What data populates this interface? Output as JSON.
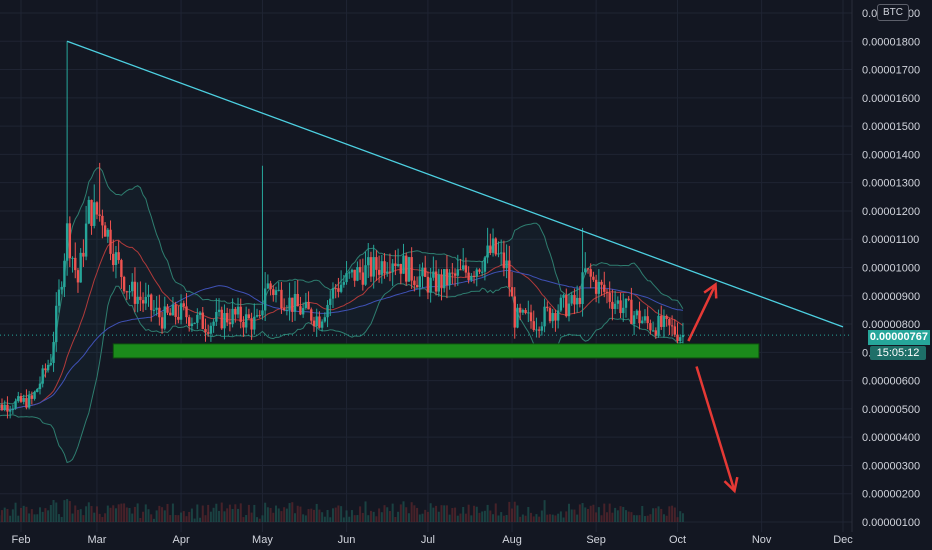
{
  "currency_label": "BTC",
  "last_price_label": "0.00000767",
  "countdown": "15:05:12",
  "colors": {
    "background": "#131722",
    "up_candle": "#26a69a",
    "down_candle": "#ef5350",
    "trendline": "#4dd0e1",
    "support_zone": "#1b8a1b",
    "arrow": "#e53935"
  },
  "chart_data": {
    "type": "candlestick",
    "y_ticks": [
      "0.00001900",
      "0.00001800",
      "0.00001700",
      "0.00001600",
      "0.00001500",
      "0.00001400",
      "0.00001300",
      "0.00001200",
      "0.00001100",
      "0.00001000",
      "0.00000900",
      "0.00000800",
      "0.00000700",
      "0.00000600",
      "0.00000500",
      "0.00000400",
      "0.00000300",
      "0.00000200",
      "0.00000100"
    ],
    "ylim": [
      7.6e-07,
      1.92e-05
    ],
    "x_ticks": [
      "Feb",
      "Mar",
      "Apr",
      "May",
      "Jun",
      "Jul",
      "Aug",
      "Sep",
      "Oct",
      "Nov",
      "Dec"
    ],
    "x_tick_dates": [
      "2021-02-01",
      "2021-03-01",
      "2021-04-01",
      "2021-05-01",
      "2021-06-01",
      "2021-07-01",
      "2021-08-01",
      "2021-09-01",
      "2021-10-01",
      "2021-11-01",
      "2021-12-01"
    ],
    "approx_series": {
      "name": "",
      "points": [
        [
          "2021-01-20",
          5e-06
        ],
        [
          "2021-02-05",
          5.3e-06
        ],
        [
          "2021-02-12",
          6.8e-06
        ],
        [
          "2021-02-15",
          9e-06
        ],
        [
          "2021-02-18",
          1.13e-05
        ],
        [
          "2021-02-22",
          9.5e-06
        ],
        [
          "2021-02-26",
          1.2e-05
        ],
        [
          "2021-03-03",
          1.18e-05
        ],
        [
          "2021-03-08",
          1.03e-05
        ],
        [
          "2021-03-12",
          9.3e-06
        ],
        [
          "2021-03-18",
          8.8e-06
        ],
        [
          "2021-03-25",
          8.2e-06
        ],
        [
          "2021-04-01",
          8.4e-06
        ],
        [
          "2021-04-10",
          8e-06
        ],
        [
          "2021-04-20",
          8.3e-06
        ],
        [
          "2021-04-30",
          8e-06
        ],
        [
          "2021-05-02",
          9.4e-06
        ],
        [
          "2021-05-08",
          9e-06
        ],
        [
          "2021-05-15",
          8.5e-06
        ],
        [
          "2021-05-22",
          8.2e-06
        ],
        [
          "2021-05-28",
          9.3e-06
        ],
        [
          "2021-06-05",
          9.8e-06
        ],
        [
          "2021-06-12",
          1e-05
        ],
        [
          "2021-06-18",
          1.04e-05
        ],
        [
          "2021-06-25",
          9.8e-06
        ],
        [
          "2021-07-02",
          9.4e-06
        ],
        [
          "2021-07-10",
          9.6e-06
        ],
        [
          "2021-07-18",
          1e-05
        ],
        [
          "2021-07-25",
          1.06e-05
        ],
        [
          "2021-07-30",
          1e-05
        ],
        [
          "2021-08-02",
          8.2e-06
        ],
        [
          "2021-08-10",
          8.1e-06
        ],
        [
          "2021-08-18",
          8.6e-06
        ],
        [
          "2021-08-25",
          8.7e-06
        ],
        [
          "2021-08-28",
          9.8e-06
        ],
        [
          "2021-09-02",
          9.3e-06
        ],
        [
          "2021-09-08",
          8.8e-06
        ],
        [
          "2021-09-14",
          8.4e-06
        ],
        [
          "2021-09-20",
          8e-06
        ],
        [
          "2021-09-26",
          7.9e-06
        ],
        [
          "2021-10-01",
          7.7e-06
        ],
        [
          "2021-10-03",
          7.6e-06
        ]
      ]
    },
    "highs": [
      [
        "2021-02-18",
        1.8e-05
      ],
      [
        "2021-03-02",
        1.37e-05
      ],
      [
        "2021-05-01",
        1.36e-05
      ],
      [
        "2021-08-27",
        1.14e-05
      ]
    ],
    "annotations": {
      "descending_trendline": [
        [
          "2021-02-18",
          1.8e-05
        ],
        [
          "2021-12-01",
          7.9e-06
        ]
      ],
      "support_zone": [
        [
          "2021-03-07",
          7.3e-06
        ],
        [
          "2021-10-31",
          6.8e-06
        ]
      ],
      "arrow_up": [
        [
          "2021-10-05",
          7.4e-06
        ],
        [
          "2021-10-15",
          9.4e-06
        ]
      ],
      "arrow_down": [
        [
          "2021-10-08",
          6.5e-06
        ],
        [
          "2021-10-22",
          2.1e-06
        ]
      ]
    }
  }
}
